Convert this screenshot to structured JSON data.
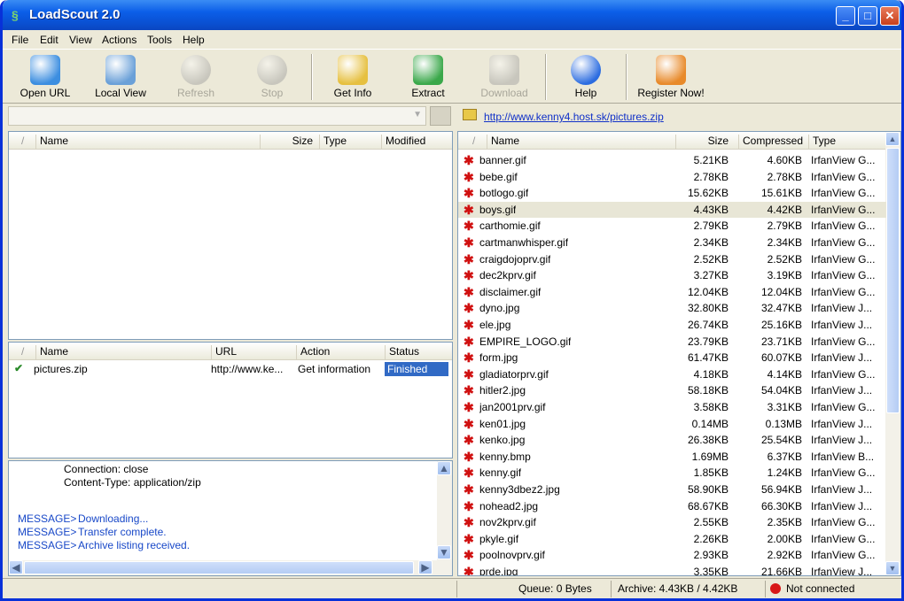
{
  "window": {
    "title": "LoadScout 2.0"
  },
  "menu": [
    "File",
    "Edit",
    "View",
    "Actions",
    "Tools",
    "Help"
  ],
  "toolbar": [
    {
      "label": "Open URL",
      "enabled": true,
      "color": "#3c8ee0"
    },
    {
      "label": "Local View",
      "enabled": true,
      "color": "#6aa0d8"
    },
    {
      "label": "Refresh",
      "enabled": false,
      "color": "#9c9c9c"
    },
    {
      "label": "Stop",
      "enabled": false,
      "color": "#9c9c9c"
    },
    {
      "label": "Get Info",
      "enabled": true,
      "color": "#e6c040"
    },
    {
      "label": "Extract",
      "enabled": true,
      "color": "#3aa84a"
    },
    {
      "label": "Download",
      "enabled": false,
      "color": "#9c9c9c"
    },
    {
      "label": "Help",
      "enabled": true,
      "color": "#2b6ce0"
    },
    {
      "label": "Register Now!",
      "enabled": true,
      "color": "#e88a2a"
    }
  ],
  "local": {
    "columns": [
      "Name",
      "Size",
      "Type",
      "Modified"
    ]
  },
  "queue": {
    "columns": [
      "Name",
      "URL",
      "Action",
      "Status"
    ],
    "rows": [
      {
        "name": "pictures.zip",
        "url": "http://www.ke...",
        "action": "Get information",
        "status": "Finished"
      }
    ]
  },
  "log": {
    "lines": [
      "Connection: close",
      "Content-Type: application/zip"
    ],
    "messages": [
      {
        "tag": "MESSAGE>",
        "text": "Downloading..."
      },
      {
        "tag": "MESSAGE>",
        "text": "Transfer complete."
      },
      {
        "tag": "MESSAGE>",
        "text": "Archive listing received."
      }
    ]
  },
  "archive": {
    "url": "http://www.kenny4.host.sk/pictures.zip",
    "columns": [
      "Name",
      "Size",
      "Compressed",
      "Type"
    ],
    "files": [
      {
        "name": "banner.gif",
        "size": "5.21KB",
        "comp": "4.60KB",
        "type": "IrfanView G..."
      },
      {
        "name": "bebe.gif",
        "size": "2.78KB",
        "comp": "2.78KB",
        "type": "IrfanView G..."
      },
      {
        "name": "botlogo.gif",
        "size": "15.62KB",
        "comp": "15.61KB",
        "type": "IrfanView G..."
      },
      {
        "name": "boys.gif",
        "size": "4.43KB",
        "comp": "4.42KB",
        "type": "IrfanView G..."
      },
      {
        "name": "carthomie.gif",
        "size": "2.79KB",
        "comp": "2.79KB",
        "type": "IrfanView G..."
      },
      {
        "name": "cartmanwhisper.gif",
        "size": "2.34KB",
        "comp": "2.34KB",
        "type": "IrfanView G..."
      },
      {
        "name": "craigdojoprv.gif",
        "size": "2.52KB",
        "comp": "2.52KB",
        "type": "IrfanView G..."
      },
      {
        "name": "dec2kprv.gif",
        "size": "3.27KB",
        "comp": "3.19KB",
        "type": "IrfanView G..."
      },
      {
        "name": "disclaimer.gif",
        "size": "12.04KB",
        "comp": "12.04KB",
        "type": "IrfanView G..."
      },
      {
        "name": "dyno.jpg",
        "size": "32.80KB",
        "comp": "32.47KB",
        "type": "IrfanView J..."
      },
      {
        "name": "ele.jpg",
        "size": "26.74KB",
        "comp": "25.16KB",
        "type": "IrfanView J..."
      },
      {
        "name": "EMPIRE_LOGO.gif",
        "size": "23.79KB",
        "comp": "23.71KB",
        "type": "IrfanView G..."
      },
      {
        "name": "form.jpg",
        "size": "61.47KB",
        "comp": "60.07KB",
        "type": "IrfanView J..."
      },
      {
        "name": "gladiatorprv.gif",
        "size": "4.18KB",
        "comp": "4.14KB",
        "type": "IrfanView G..."
      },
      {
        "name": "hitler2.jpg",
        "size": "58.18KB",
        "comp": "54.04KB",
        "type": "IrfanView J..."
      },
      {
        "name": "jan2001prv.gif",
        "size": "3.58KB",
        "comp": "3.31KB",
        "type": "IrfanView G..."
      },
      {
        "name": "ken01.jpg",
        "size": "0.14MB",
        "comp": "0.13MB",
        "type": "IrfanView J..."
      },
      {
        "name": "kenko.jpg",
        "size": "26.38KB",
        "comp": "25.54KB",
        "type": "IrfanView J..."
      },
      {
        "name": "kenny.bmp",
        "size": "1.69MB",
        "comp": "6.37KB",
        "type": "IrfanView B..."
      },
      {
        "name": "kenny.gif",
        "size": "1.85KB",
        "comp": "1.24KB",
        "type": "IrfanView G..."
      },
      {
        "name": "kenny3dbez2.jpg",
        "size": "58.90KB",
        "comp": "56.94KB",
        "type": "IrfanView J..."
      },
      {
        "name": "nohead2.jpg",
        "size": "68.67KB",
        "comp": "66.30KB",
        "type": "IrfanView J..."
      },
      {
        "name": "nov2kprv.gif",
        "size": "2.55KB",
        "comp": "2.35KB",
        "type": "IrfanView G..."
      },
      {
        "name": "pkyle.gif",
        "size": "2.26KB",
        "comp": "2.00KB",
        "type": "IrfanView G..."
      },
      {
        "name": "poolnovprv.gif",
        "size": "2.93KB",
        "comp": "2.92KB",
        "type": "IrfanView G..."
      },
      {
        "name": "prde.jpg",
        "size": "3.35KB",
        "comp": "21.66KB",
        "type": "IrfanView J..."
      }
    ],
    "selected_index": 3
  },
  "status": {
    "queue": "Queue: 0 Bytes",
    "archive": "Archive: 4.43KB / 4.42KB",
    "connection": "Not connected"
  }
}
